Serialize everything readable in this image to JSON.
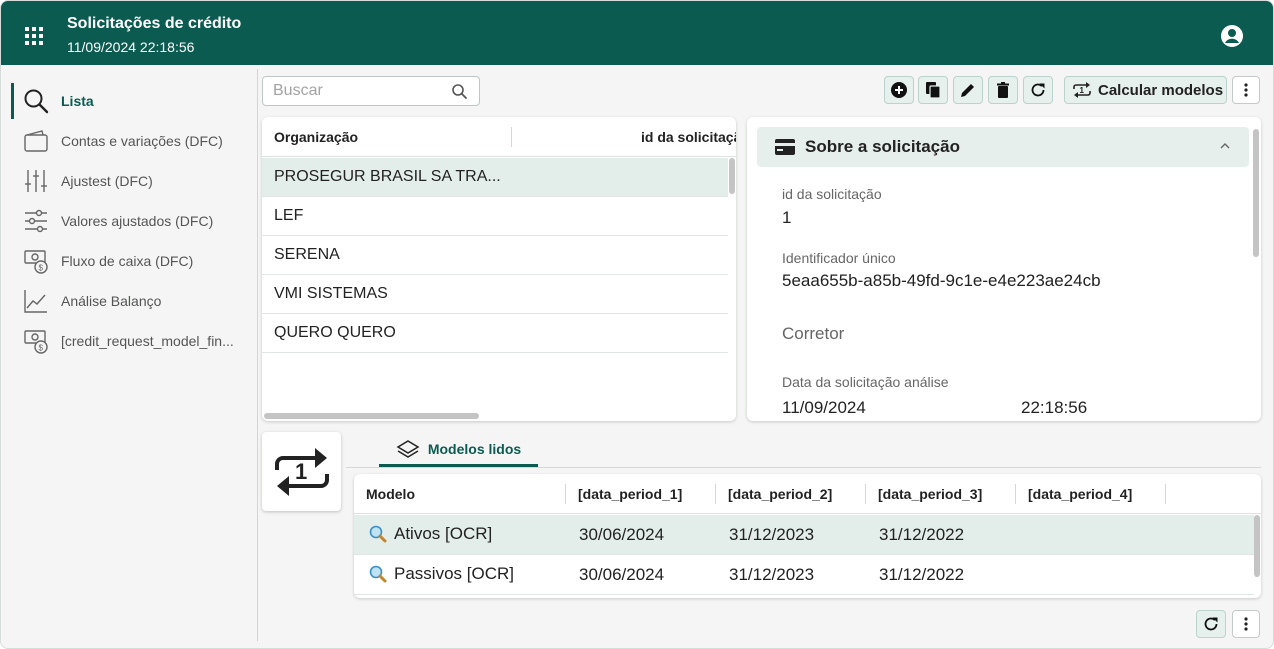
{
  "header": {
    "title": "Solicitações de crédito",
    "subtitle": "11/09/2024 22:18:56",
    "color": "#0b5b51"
  },
  "sidebar": {
    "items": [
      {
        "label": "Lista",
        "icon": "search-icon",
        "active": true
      },
      {
        "label": "Contas e variações (DFC)",
        "icon": "wallet-icon",
        "active": false
      },
      {
        "label": "Ajustest (DFC)",
        "icon": "sliders-vertical-icon",
        "active": false
      },
      {
        "label": "Valores ajustados (DFC)",
        "icon": "sliders-horizontal-icon",
        "active": false
      },
      {
        "label": "Fluxo de caixa (DFC)",
        "icon": "cash-flow-icon",
        "active": false
      },
      {
        "label": "Análise Balanço",
        "icon": "line-chart-icon",
        "active": false
      },
      {
        "label": "[credit_request_model_fin...",
        "icon": "cash-flow-icon",
        "active": false
      }
    ]
  },
  "toolbar": {
    "search_placeholder": "Buscar",
    "search_value": "",
    "calc_label": "Calcular modelos",
    "icons": [
      "add-icon",
      "copy-icon",
      "edit-icon",
      "delete-icon",
      "refresh-icon",
      "repeat-one-icon",
      "more-vert-icon"
    ]
  },
  "org_table": {
    "columns": [
      "Organização",
      "id da solicitaçã"
    ],
    "rows": [
      {
        "org": "PROSEGUR BRASIL SA TRA...",
        "selected": true
      },
      {
        "org": "LEF",
        "selected": false
      },
      {
        "org": "SERENA",
        "selected": false
      },
      {
        "org": "VMI SISTEMAS",
        "selected": false
      },
      {
        "org": "QUERO QUERO",
        "selected": false
      }
    ]
  },
  "detail": {
    "title": "Sobre a solicitação",
    "id_label": "id da solicitação",
    "id_value": "1",
    "uid_label": "Identificador único",
    "uid_value": "5eaa655b-a85b-49fd-9c1e-e4e223ae24cb",
    "broker_label": "Corretor",
    "date_label": "Data da solicitação análise",
    "date_value": "11/09/2024",
    "time_value": "22:18:56"
  },
  "models": {
    "tab_label": "Modelos lidos",
    "columns": [
      "Modelo",
      "[data_period_1]",
      "[data_period_2]",
      "[data_period_3]",
      "[data_period_4]"
    ],
    "rows": [
      {
        "name": "Ativos [OCR]",
        "p1": "30/06/2024",
        "p2": "31/12/2023",
        "p3": "31/12/2022",
        "p4": "",
        "selected": true
      },
      {
        "name": "Passivos [OCR]",
        "p1": "30/06/2024",
        "p2": "31/12/2023",
        "p3": "31/12/2022",
        "p4": "",
        "selected": false
      }
    ]
  }
}
